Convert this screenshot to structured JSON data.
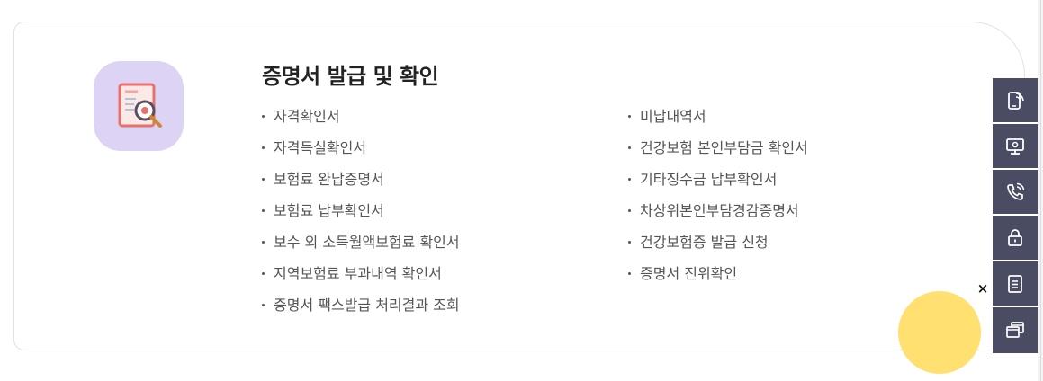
{
  "card": {
    "title": "증명서 발급 및 확인",
    "icon": "document-search-icon",
    "left_items": [
      "자격확인서",
      "자격득실확인서",
      "보험료 완납증명서",
      "보험료 납부확인서",
      "보수 외 소득월액보험료 확인서",
      "지역보험료 부과내역 확인서",
      "증명서 팩스발급 처리결과 조회"
    ],
    "right_items": [
      "미납내역서",
      "건강보험 본인부담금 확인서",
      "기타징수금 납부확인서",
      "차상위본인부담경감증명서",
      "건강보험증 발급 신청",
      "증명서 진위확인"
    ]
  },
  "quick_bar": {
    "icons": [
      "mobile-app-icon",
      "monitor-icon",
      "phone-call-icon",
      "lock-icon",
      "document-icon",
      "windows-icon"
    ]
  },
  "popup": {
    "close_label": "×"
  },
  "colors": {
    "icon_bg": "#dcd3f5",
    "quick_bar_bg": "#4a4c63",
    "circle": "#ffe070",
    "doc_border": "#e8706a"
  }
}
